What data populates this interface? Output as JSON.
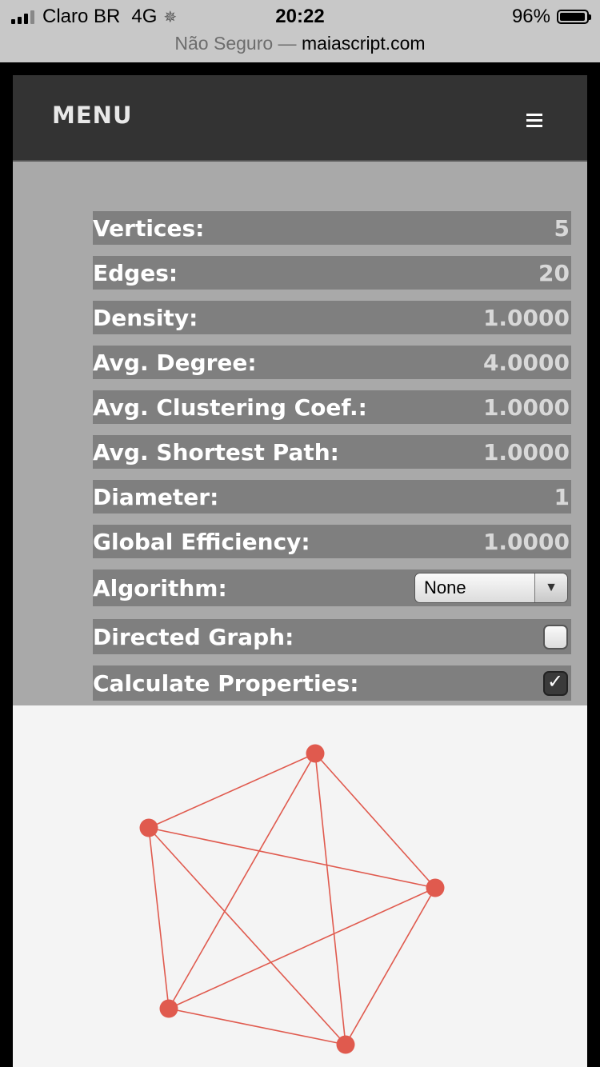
{
  "status_bar": {
    "carrier": "Claro BR",
    "network": "4G",
    "time": "20:22",
    "battery_percent": "96%",
    "battery_level": 0.96
  },
  "url_bar": {
    "security_text": "Não Seguro —",
    "host": "maiascript.com"
  },
  "nav": {
    "title": "MENU",
    "menu_icon": "hamburger-icon"
  },
  "properties": [
    {
      "label": "Vertices:",
      "value": "5"
    },
    {
      "label": "Edges:",
      "value": "20"
    },
    {
      "label": "Density:",
      "value": "1.0000"
    },
    {
      "label": "Avg. Degree:",
      "value": "4.0000"
    },
    {
      "label": "Avg. Clustering Coef.:",
      "value": "1.0000"
    },
    {
      "label": "Avg. Shortest Path:",
      "value": "1.0000"
    },
    {
      "label": "Diameter:",
      "value": "1"
    },
    {
      "label": "Global Efficiency:",
      "value": "1.0000"
    }
  ],
  "controls": {
    "algorithm_label": "Algorithm:",
    "algorithm_selected": "None",
    "directed_label": "Directed Graph:",
    "directed_checked": false,
    "calculate_label": "Calculate Properties:",
    "calculate_checked": true
  },
  "graph": {
    "node_color": "#e05a4e",
    "edge_color": "#e05a4e",
    "background": "#f4f4f4",
    "node_count": 5,
    "edges": [
      [
        0,
        1
      ],
      [
        0,
        2
      ],
      [
        0,
        3
      ],
      [
        0,
        4
      ],
      [
        1,
        2
      ],
      [
        1,
        3
      ],
      [
        1,
        4
      ],
      [
        2,
        3
      ],
      [
        2,
        4
      ],
      [
        3,
        4
      ]
    ]
  }
}
